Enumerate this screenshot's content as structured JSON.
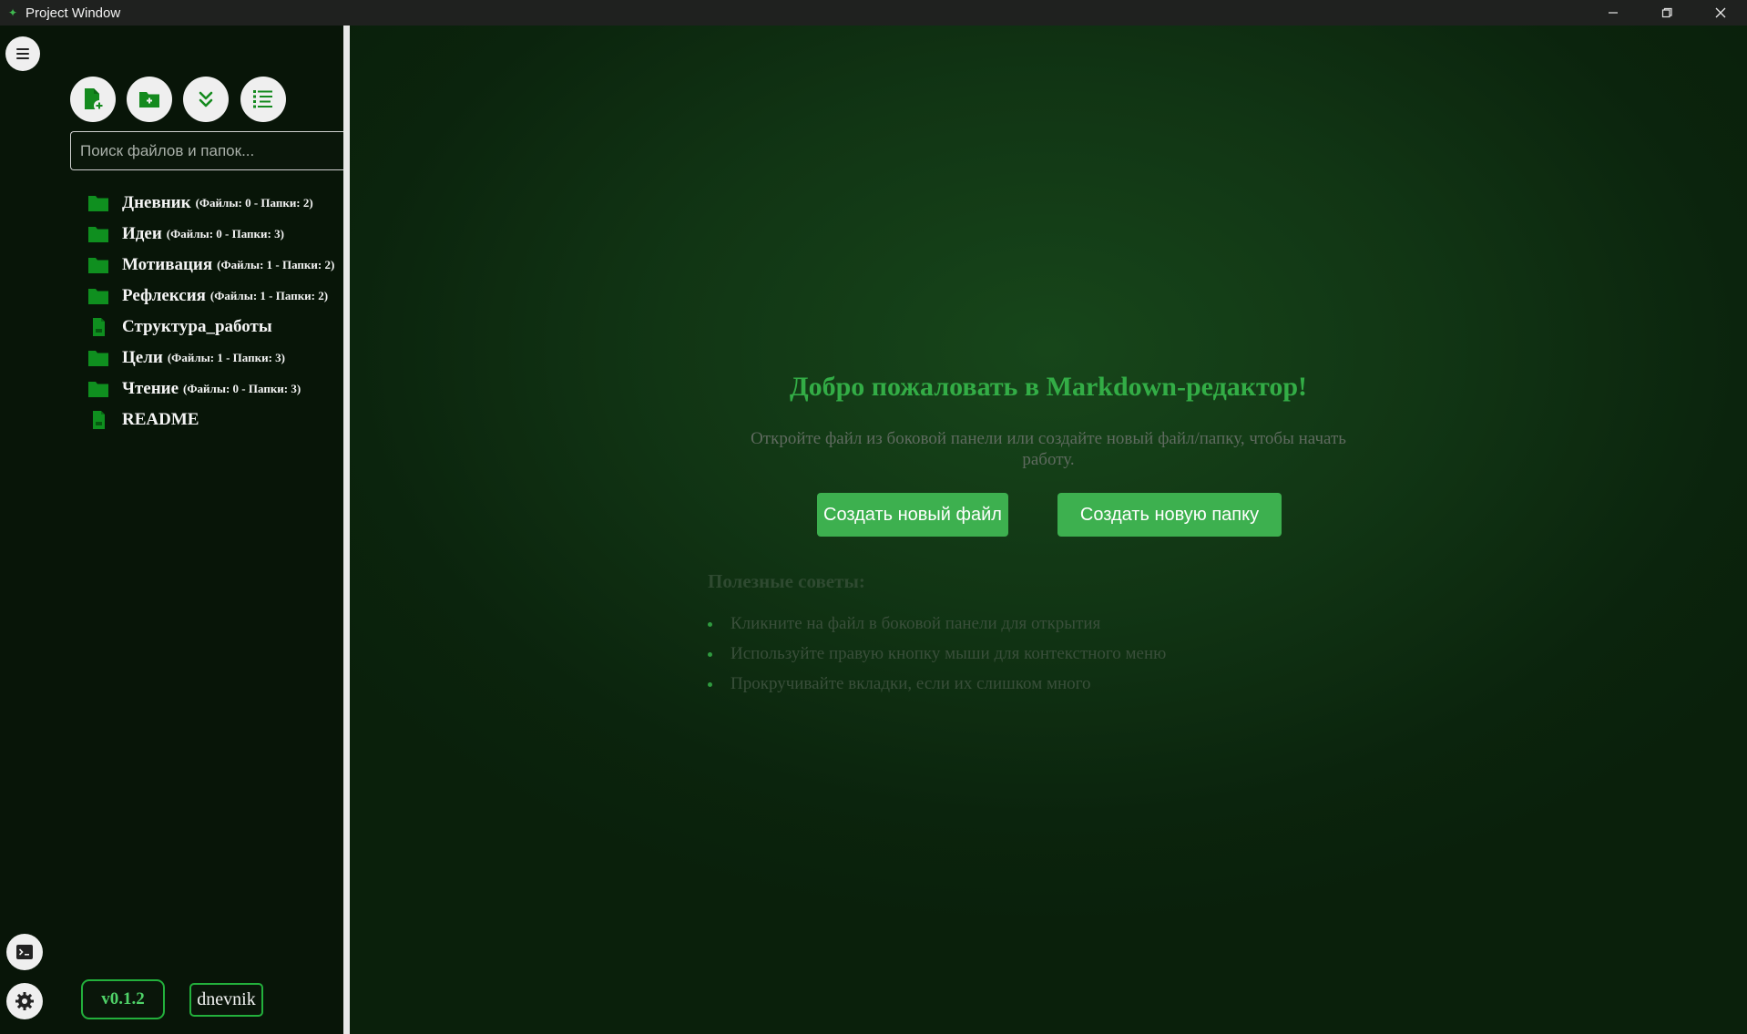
{
  "window": {
    "title": "Project Window"
  },
  "sidebar": {
    "search_placeholder": "Поиск файлов и папок...",
    "tree": [
      {
        "type": "folder",
        "name": "Дневник",
        "count": "(Файлы: 0 - Папки: 2)"
      },
      {
        "type": "folder",
        "name": "Идеи",
        "count": "(Файлы: 0 - Папки: 3)"
      },
      {
        "type": "folder",
        "name": "Мотивация",
        "count": "(Файлы: 1 - Папки: 2)"
      },
      {
        "type": "folder",
        "name": "Рефлексия",
        "count": "(Файлы: 1 - Папки: 2)"
      },
      {
        "type": "file",
        "name": "Структура_работы",
        "count": ""
      },
      {
        "type": "folder",
        "name": "Цели",
        "count": "(Файлы: 1 - Папки: 3)"
      },
      {
        "type": "folder",
        "name": "Чтение",
        "count": "(Файлы: 0 - Папки: 3)"
      },
      {
        "type": "file",
        "name": "README",
        "count": ""
      }
    ],
    "version": "v0.1.2",
    "project": "dnevnik"
  },
  "main": {
    "welcome_title": "Добро пожаловать в Markdown-редактор!",
    "welcome_subtitle": "Откройте файл из боковой панели или создайте новый файл/папку, чтобы начать работу.",
    "create_file_label": "Создать новый файл",
    "create_folder_label": "Создать новую папку",
    "tips_title": "Полезные советы:",
    "tips": [
      "Кликните на файл в боковой панели для открытия",
      "Используйте правую кнопку мыши для контекстного меню",
      "Прокручивайте вкладки, если их слишком много"
    ]
  },
  "colors": {
    "accent": "#3db04f",
    "folder_icon": "#0f8f1f",
    "title_green": "#33ad46"
  }
}
